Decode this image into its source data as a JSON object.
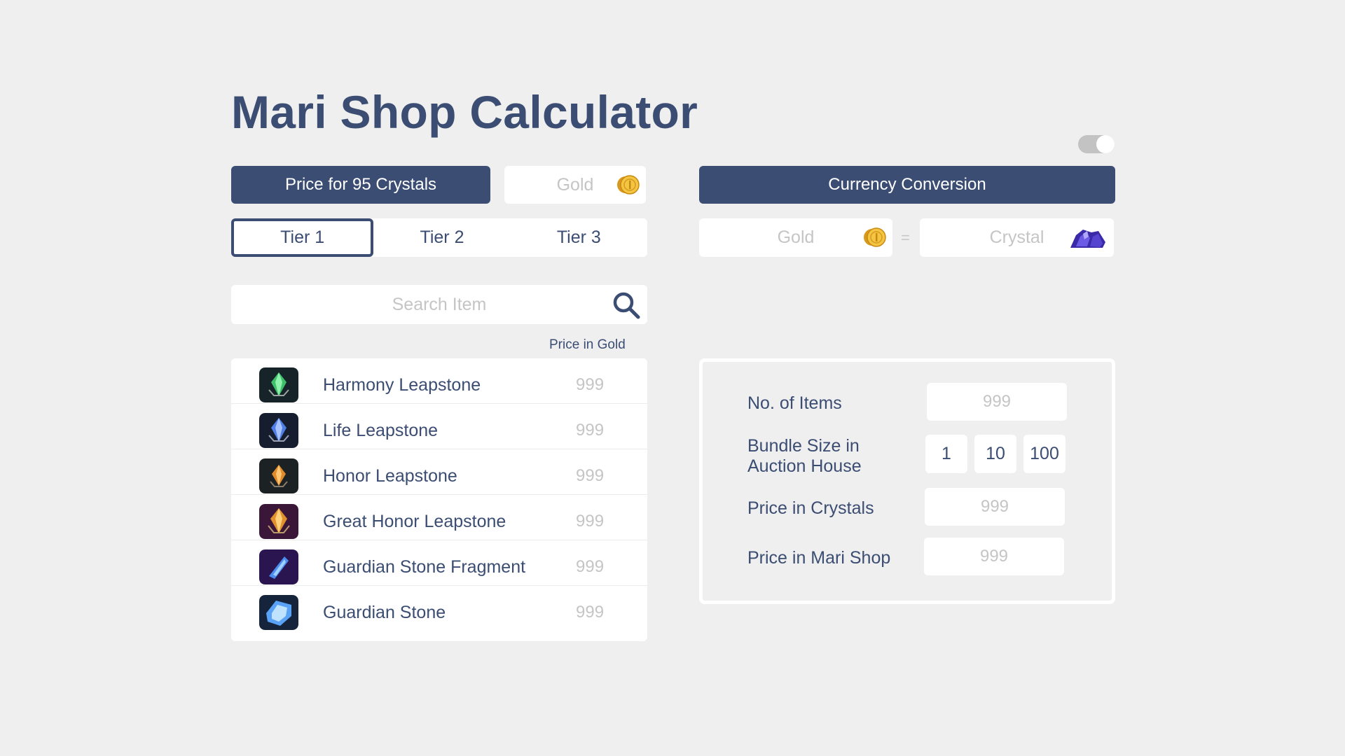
{
  "title": "Mari Shop Calculator",
  "left_panel": {
    "price_button": "Price for 95 Crystals",
    "gold_placeholder": "Gold",
    "tiers": [
      "Tier 1",
      "Tier 2",
      "Tier 3"
    ],
    "active_tier": "Tier 1",
    "search_placeholder": "Search Item",
    "price_header": "Price in Gold",
    "items": [
      {
        "name": "Harmony Leapstone",
        "price": "999",
        "icon": "harmony-leapstone-icon",
        "color": "#3fbf6a"
      },
      {
        "name": "Life Leapstone",
        "price": "999",
        "icon": "life-leapstone-icon",
        "color": "#4f7fe6"
      },
      {
        "name": "Honor Leapstone",
        "price": "999",
        "icon": "honor-leapstone-icon",
        "color": "#e08a2c"
      },
      {
        "name": "Great Honor Leapstone",
        "price": "999",
        "icon": "great-honor-leapstone-icon",
        "color": "#e0902c"
      },
      {
        "name": "Guardian Stone Fragment",
        "price": "999",
        "icon": "guardian-stone-fragment-icon",
        "color": "#4a8cf0"
      },
      {
        "name": "Guardian Stone",
        "price": "999",
        "icon": "guardian-stone-icon",
        "color": "#5aa2f5"
      }
    ]
  },
  "right_panel": {
    "conversion_button": "Currency Conversion",
    "gold_placeholder": "Gold",
    "equals": "=",
    "crystal_placeholder": "Crystal",
    "calculator": {
      "items_label": "No. of Items",
      "items_value": "999",
      "bundle_label_line1": "Bundle Size in",
      "bundle_label_line2": "Auction House",
      "bundle_options": [
        "1",
        "10",
        "100"
      ],
      "crystals_label": "Price in Crystals",
      "crystals_value": "999",
      "mari_label": "Price in Mari Shop",
      "mari_value": "999"
    }
  },
  "colors": {
    "primary": "#3b4d72",
    "background": "#efefef",
    "placeholder": "#c5c5c5"
  }
}
